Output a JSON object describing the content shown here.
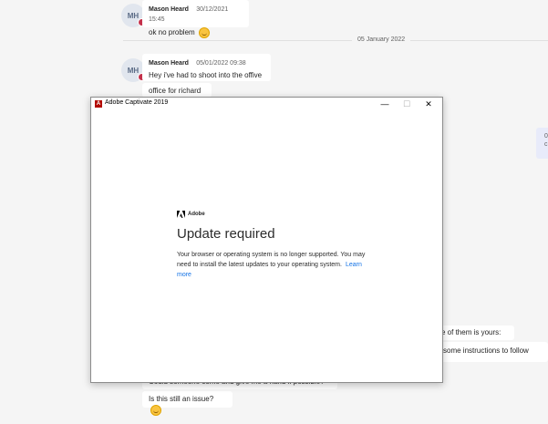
{
  "chat": {
    "msg1": {
      "initials": "MH",
      "sender": "Mason Heard",
      "time": "30/12/2021 15:45",
      "text": "ok no problem"
    },
    "date_divider": "05 January 2022",
    "msg2": {
      "initials": "MH",
      "sender": "Mason Heard",
      "time": "05/01/2022 09:38",
      "text": "Hey i've had to shoot into the offive",
      "text2": "office for richard"
    },
    "right_fragment_1": "0",
    "right_fragment_2": "c",
    "partial_text_1": "e of them is yours:",
    "partial_text_2": "some instructions to follow",
    "partial_text_3": "Could someone come and give me a hand if possible?",
    "last_message": "Is this still an issue?"
  },
  "dialog": {
    "title": "Adobe Captivate 2019",
    "app_icon_letter": "A",
    "brand": "Adobe",
    "heading": "Update required",
    "body": "Your browser or operating system is no longer supported. You may need to install the latest updates to your operating system.",
    "link": "Learn more",
    "controls": {
      "minimize": "—",
      "maximize": "☐",
      "close": "✕"
    }
  }
}
